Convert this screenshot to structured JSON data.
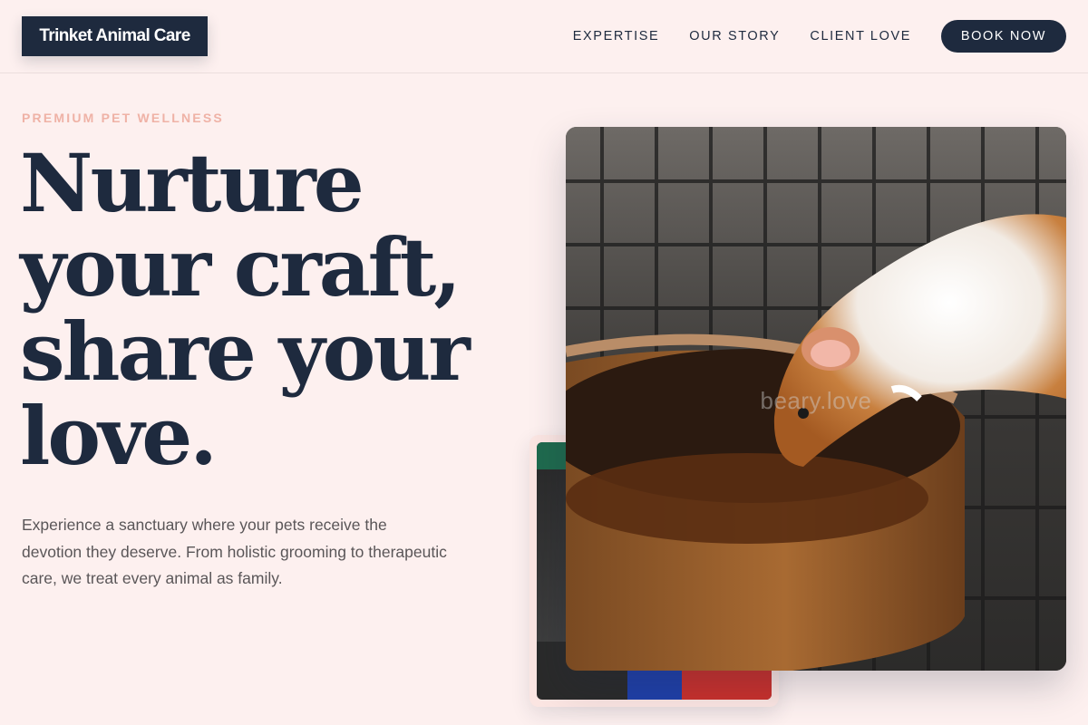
{
  "brand": {
    "name": "Trinket Animal Care"
  },
  "nav": {
    "items": [
      {
        "label": "EXPERTISE"
      },
      {
        "label": "OUR STORY"
      },
      {
        "label": "CLIENT LOVE"
      }
    ],
    "cta_label": "BOOK NOW"
  },
  "hero": {
    "eyebrow": "PREMIUM PET WELLNESS",
    "headline_lines": [
      "Nurture",
      "your craft,",
      "share your",
      "love."
    ],
    "description": "Experience a sanctuary where your pets receive the devotion they deserve. From holistic grooming to therapeutic care, we treat every animal as family.",
    "image_watermark": "beary.love"
  },
  "colors": {
    "background": "#fdf0ef",
    "navy": "#1e2a3e",
    "accent_pink": "#efb2a6",
    "body_text": "#5a5658"
  }
}
